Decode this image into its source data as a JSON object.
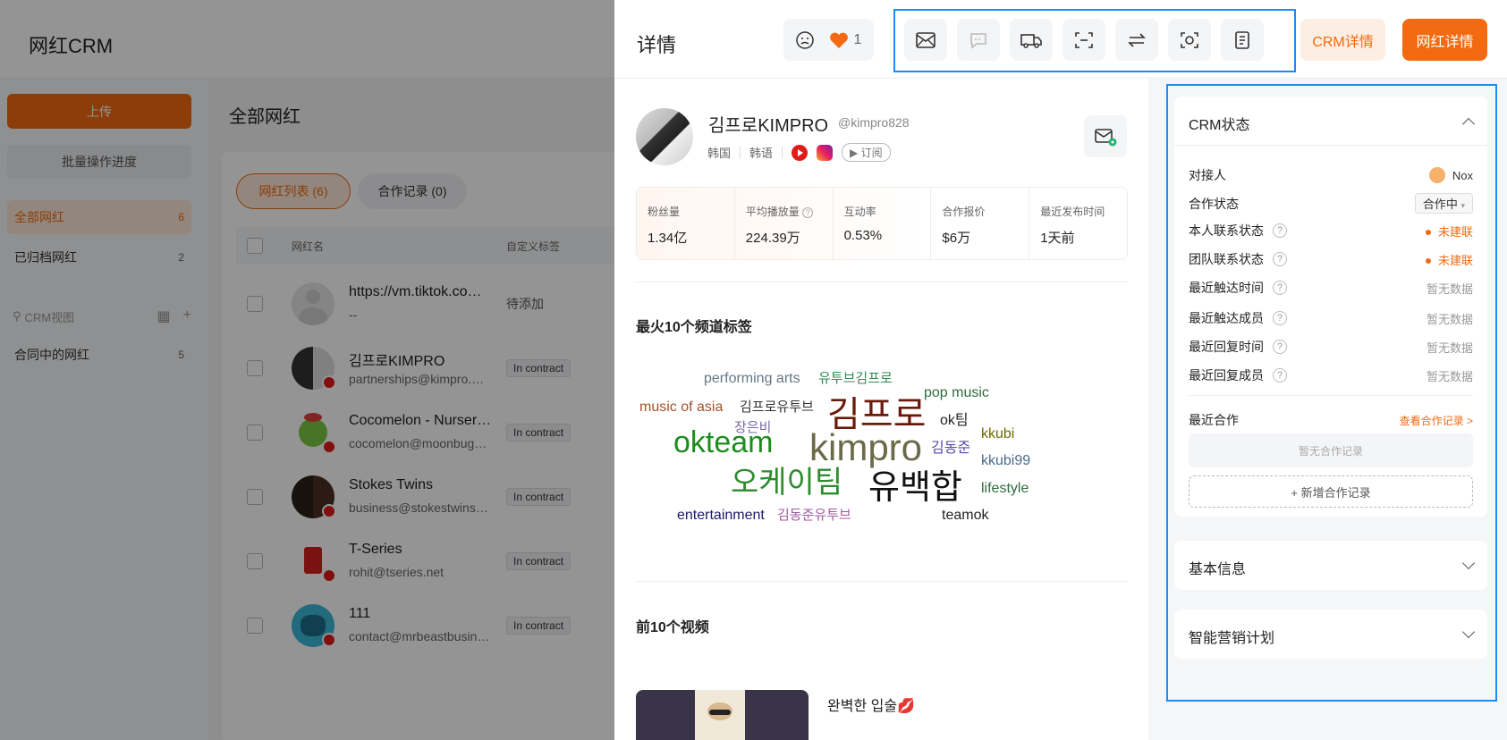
{
  "app": {
    "title": "网红CRM"
  },
  "sidebar": {
    "upload_label": "上传",
    "batch_label": "批量操作进度",
    "items": [
      {
        "label": "全部网红",
        "count": "6"
      },
      {
        "label": "已归档网红",
        "count": "2"
      },
      {
        "label": "合同中的网红",
        "count": "5"
      }
    ],
    "crm_view_placeholder": "CRM视图"
  },
  "main": {
    "title": "全部网红",
    "tabs": [
      {
        "label": "网红列表 (6)"
      },
      {
        "label": "合作记录 (0)"
      }
    ],
    "columns": [
      "网红名",
      "自定义标签"
    ],
    "rows": [
      {
        "name": "https://vm.tiktok.com/ZMr...",
        "email": "--",
        "tag": "待添加"
      },
      {
        "name": "김프로KIMPRO",
        "email": "partnerships@kimpro.com",
        "tag": "In contract"
      },
      {
        "name": "Cocomelon - Nursery Rhymes",
        "email": "cocomelon@moonbug.com",
        "tag": "In contract"
      },
      {
        "name": "Stokes Twins",
        "email": "business@stokestwins.com",
        "tag": "In contract"
      },
      {
        "name": "T-Series",
        "email": "rohit@tseries.net",
        "tag": "In contract"
      },
      {
        "name": "111",
        "email": "contact@mrbeastbusiness.com",
        "tag": "In contract"
      }
    ]
  },
  "drawer": {
    "title": "详情",
    "like_count": "1",
    "crm_button": "CRM详情",
    "influencer_button": "网红详情",
    "profile": {
      "name": "김프로KIMPRO",
      "handle": "@kimpro828",
      "country": "韩国",
      "language": "韩语",
      "subscribe_label": "订阅"
    },
    "stats": [
      {
        "label": "粉丝量",
        "value": "1.34亿"
      },
      {
        "label": "平均播放量",
        "value": "224.39万"
      },
      {
        "label": "互动率",
        "value": "0.53%"
      },
      {
        "label": "合作报价",
        "value": "$6万"
      },
      {
        "label": "最近发布时间",
        "value": "1天前"
      }
    ],
    "tags_title": "最火10个频道标签",
    "tags": [
      {
        "text": "performing arts",
        "color": "#667788"
      },
      {
        "text": "유투브김프로",
        "color": "#2e8b57"
      },
      {
        "text": "pop music",
        "color": "#2e6b3e"
      },
      {
        "text": "music of asia",
        "color": "#a0522d"
      },
      {
        "text": "김프로유투브",
        "color": "#333333"
      },
      {
        "text": "김프로",
        "color": "#6b1a0a"
      },
      {
        "text": "ok팀",
        "color": "#222222"
      },
      {
        "text": "장은비",
        "color": "#7a6aa8"
      },
      {
        "text": "okteam",
        "color": "#1e8c1e"
      },
      {
        "text": "kimpro",
        "color": "#6b6b4a"
      },
      {
        "text": "kkubi",
        "color": "#6b6b00"
      },
      {
        "text": "김동준",
        "color": "#5a4aa8"
      },
      {
        "text": "kkubi99",
        "color": "#4a6a8a"
      },
      {
        "text": "오케이팀",
        "color": "#2e8b2e"
      },
      {
        "text": "유백합",
        "color": "#111111"
      },
      {
        "text": "lifestyle",
        "color": "#2e6b3e"
      },
      {
        "text": "entertainment",
        "color": "#1a1a6b"
      },
      {
        "text": "김동준유투브",
        "color": "#a05aa0"
      },
      {
        "text": "teamok",
        "color": "#222222"
      }
    ],
    "videos_title": "前10个视频",
    "video_title": "완벽한 입술💋"
  },
  "crm": {
    "title": "CRM状态",
    "contact_label": "对接人",
    "contact_value": "Nox",
    "coop_label": "合作状态",
    "coop_value": "合作中",
    "fields": [
      {
        "label": "本人联系状态",
        "value": "未建联",
        "status": true
      },
      {
        "label": "团队联系状态",
        "value": "未建联",
        "status": true
      },
      {
        "label": "最近触达时间",
        "value": "暂无数据",
        "status": false
      },
      {
        "label": "最近触达成员",
        "value": "暂无数据",
        "status": false
      },
      {
        "label": "最近回复时间",
        "value": "暂无数据",
        "status": false
      },
      {
        "label": "最近回复成员",
        "value": "暂无数据",
        "status": false
      }
    ],
    "recent_coop_label": "最近合作",
    "view_records_link": "查看合作记录 >",
    "no_records": "暂无合作记录",
    "add_record": "+ 新增合作记录",
    "basic_info": "基本信息",
    "smart_plan": "智能营销计划"
  },
  "colors": {
    "accent": "#f26a11",
    "highlight": "#1a8cff"
  }
}
